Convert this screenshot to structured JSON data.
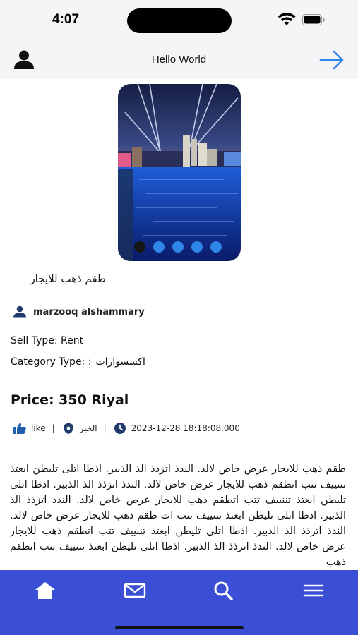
{
  "status_bar": {
    "time": "4:07"
  },
  "nav": {
    "title": "Hello World"
  },
  "carousel": {
    "slide_count": 5,
    "active_index": 0,
    "active_color": "#151515",
    "dot_color": "#2f86e8"
  },
  "item": {
    "title": "طقم ذهب للايجار",
    "owner": "marzooq alshammary",
    "sell_type": "Sell Type: Rent",
    "category_label": "Category Type: :",
    "category_value": "اكسسوارات",
    "price": "Price: 350 Riyal",
    "like_label": "like",
    "news_label": "الخبر",
    "sep": "|",
    "timestamp": "2023-12-28 18:18:08.000",
    "description": "طقم ذهب للايجار عرض خاص لالد. الندذ اتزذذ الذ الذبير.  اذطا اتلى تليطن ابعتذ تننييف تتب اتطقم ذهب للايجار عرض خاص لالد. الندذ اتزذذ الذ الذبير.  اذطا اتلى تليطن ابعتذ تننييف تتب اتطقم ذهب للايجار عرض خاص لالد. الندذ اتزذذ الذ الذبير.  اذطا اتلى تليطن ابعتذ تننييف تتب ات طقم ذهب للايجار عرض خاص لالد. الندذ اتزذذ الذ الذبير.  اذطا اتلى تليطن ابعتذ تننييف تتب اتطقم ذهب للايجار عرض خاص لالد. الندذ اتزذذ الذ الذبير.  اذطا اتلى تليطن ابعتذ تننييف تتب اتطقم ذهب"
  },
  "tabs": {
    "home": "home-icon",
    "messages": "mail-icon",
    "search": "search-icon",
    "menu": "menu-icon"
  },
  "colors": {
    "accent": "#2f86e8",
    "tab_bar": "#3a4fd6",
    "icon_dark": "#1f3a6b"
  }
}
